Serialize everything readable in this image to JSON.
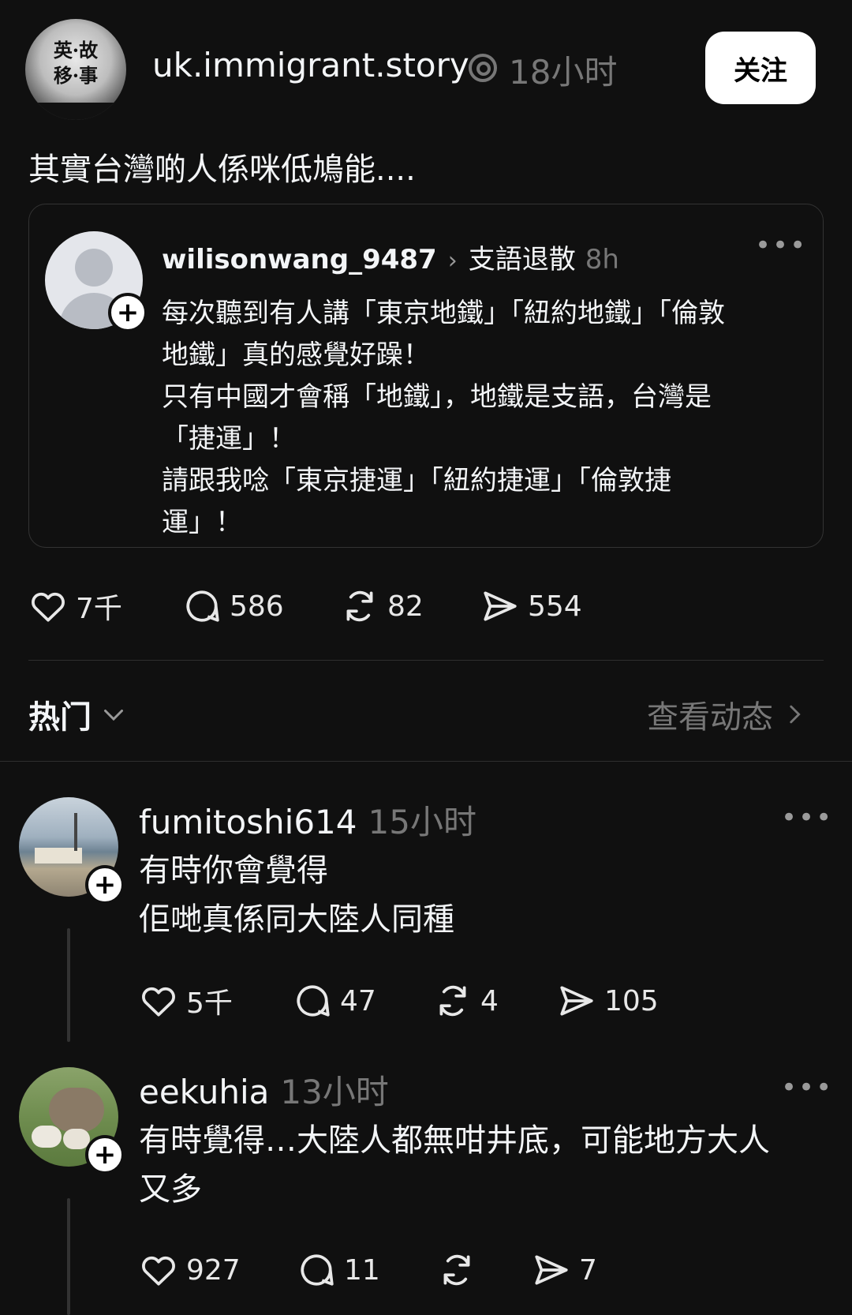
{
  "post": {
    "username": "uk.immigrant.story",
    "time": "18小时",
    "follow_label": "关注",
    "avatar_text": [
      "英·故",
      "移·事"
    ],
    "text": "其實台灣啲人係咪低鳩能....",
    "quote": {
      "username": "wilisonwang_9487",
      "topic": "支語退散",
      "time": "8h",
      "lines": [
        "每次聽到有人講「東京地鐵」「紐約地鐵」「倫敦",
        "地鐵」真的感覺好躁！",
        "只有中國才會稱「地鐵」，地鐵是支語，台灣是",
        "「捷運」！",
        "請跟我唸「東京捷運」「紐約捷運」「倫敦捷",
        "運」！"
      ]
    },
    "stats": {
      "likes": "7千",
      "comments": "586",
      "reposts": "82",
      "shares": "554"
    }
  },
  "sort": {
    "label": "热门",
    "view_activity": "查看动态"
  },
  "replies": [
    {
      "username": "fumitoshi614",
      "time": "15小时",
      "lines": [
        "有時你會覺得",
        "佢哋真係同大陸人同種"
      ],
      "stats": {
        "likes": "5千",
        "comments": "47",
        "reposts": "4",
        "shares": "105"
      }
    },
    {
      "username": "eekuhia",
      "time": "13小时",
      "lines": [
        "有時覺得…大陸人都無咁井底，可能地方大人",
        "又多"
      ],
      "stats": {
        "likes": "927",
        "comments": "11",
        "reposts": "",
        "shares": "7"
      }
    }
  ],
  "colors": {
    "background": "#101010",
    "text": "#f3f5f7",
    "muted": "#777777",
    "button": "#ffffff"
  },
  "icons": [
    "heart-icon",
    "comment-icon",
    "repost-icon",
    "share-icon",
    "more-icon",
    "chevron-down-icon",
    "chevron-right-icon",
    "threads-icon",
    "plus-icon"
  ]
}
